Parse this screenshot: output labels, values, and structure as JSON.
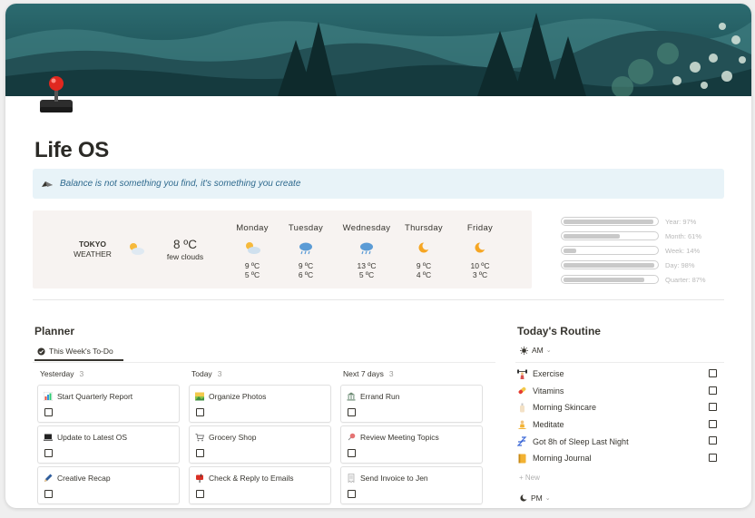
{
  "page": {
    "title": "Life OS",
    "icon": "joystick-icon"
  },
  "callout": {
    "icon": "paper-plane-icon",
    "text": "Balance is not something you find, it's something you create"
  },
  "weather": {
    "city": "TOKYO",
    "label": "WEATHER",
    "current": {
      "icon": "sun-cloud-icon",
      "temp": "8 ºC",
      "desc": "few clouds"
    },
    "days": [
      {
        "name": "Monday",
        "icon": "sun-cloud-icon",
        "high": "9 ºC",
        "low": "5 ºC"
      },
      {
        "name": "Tuesday",
        "icon": "rain-cloud-icon",
        "high": "9 ºC",
        "low": "6 ºC"
      },
      {
        "name": "Wednesday",
        "icon": "rain-cloud-icon",
        "high": "13 ºC",
        "low": "5 ºC"
      },
      {
        "name": "Thursday",
        "icon": "moon-icon",
        "high": "9 ºC",
        "low": "4 ºC"
      },
      {
        "name": "Friday",
        "icon": "moon-icon",
        "high": "10 ºC",
        "low": "3 ºC"
      }
    ]
  },
  "progress": [
    {
      "label": "Year: 97%",
      "value": 0.97
    },
    {
      "label": "Month: 61%",
      "value": 0.61
    },
    {
      "label": "Week: 14%",
      "value": 0.14
    },
    {
      "label": "Day: 98%",
      "value": 0.98
    },
    {
      "label": "Quarter: 87%",
      "value": 0.87
    }
  ],
  "planner": {
    "title": "Planner",
    "tab": "This Week's To-Do",
    "columns": [
      {
        "name": "Yesterday",
        "count": "3",
        "cards": [
          {
            "title": "Start Quarterly Report",
            "icon": "bar-chart-icon"
          },
          {
            "title": "Update to Latest OS",
            "icon": "laptop-icon"
          },
          {
            "title": "Creative Recap",
            "icon": "pencil-icon"
          }
        ]
      },
      {
        "name": "Today",
        "count": "3",
        "cards": [
          {
            "title": "Organize Photos",
            "icon": "picture-icon"
          },
          {
            "title": "Grocery Shop",
            "icon": "cart-icon"
          },
          {
            "title": "Check & Reply to Emails",
            "icon": "mailbox-icon"
          }
        ]
      },
      {
        "name": "Next 7 days",
        "count": "3",
        "cards": [
          {
            "title": "Errand Run",
            "icon": "bank-icon"
          },
          {
            "title": "Review Meeting Topics",
            "icon": "pin-icon"
          },
          {
            "title": "Send Invoice to Jen",
            "icon": "receipt-icon"
          }
        ]
      }
    ]
  },
  "routine": {
    "title": "Today's Routine",
    "am": "AM",
    "pm": "PM",
    "new_label": "+ New",
    "items": [
      {
        "label": "Exercise",
        "icon": "weightlifter-icon"
      },
      {
        "label": "Vitamins",
        "icon": "pill-icon"
      },
      {
        "label": "Morning Skincare",
        "icon": "lotion-bottle-icon"
      },
      {
        "label": "Meditate",
        "icon": "meditation-icon"
      },
      {
        "label": "Got 8h of Sleep Last Night",
        "icon": "zzz-icon"
      },
      {
        "label": "Morning Journal",
        "icon": "journal-icon"
      }
    ]
  },
  "colors": {
    "callout_bg": "#e8f3f8",
    "callout_text": "#2f6a8e",
    "weather_bg": "#f7f3f1",
    "cover_sky": "#1f5a60"
  }
}
